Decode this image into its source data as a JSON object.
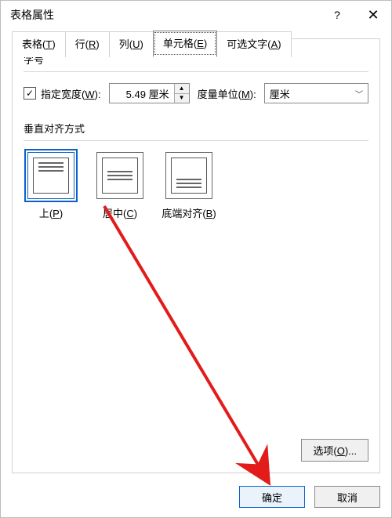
{
  "title": "表格属性",
  "tabs": {
    "table": {
      "label": "表格",
      "hot": "T"
    },
    "row": {
      "label": "行",
      "hot": "R"
    },
    "column": {
      "label": "列",
      "hot": "U"
    },
    "cell": {
      "label": "单元格",
      "hot": "E"
    },
    "alttext": {
      "label": "可选文字",
      "hot": "A"
    }
  },
  "size": {
    "group": "字号",
    "cb": {
      "label": "指定宽度",
      "hot": "W",
      "checked": true
    },
    "width": "5.49 厘米",
    "unit_label": "度量单位",
    "unit_hot": "M",
    "unit_value": "厘米"
  },
  "valign": {
    "group": "垂直对齐方式",
    "top": {
      "label": "上",
      "hot": "P"
    },
    "center": {
      "label": "居中",
      "hot": "C"
    },
    "bottom": {
      "label": "底端对齐",
      "hot": "B"
    }
  },
  "options": {
    "label": "选项",
    "hot": "O"
  },
  "buttons": {
    "ok": "确定",
    "cancel": "取消"
  },
  "symbols": {
    "qmark": "?",
    "close": "✕",
    "up": "▲",
    "down": "▼",
    "chev": "﹀",
    "check": "✓"
  }
}
